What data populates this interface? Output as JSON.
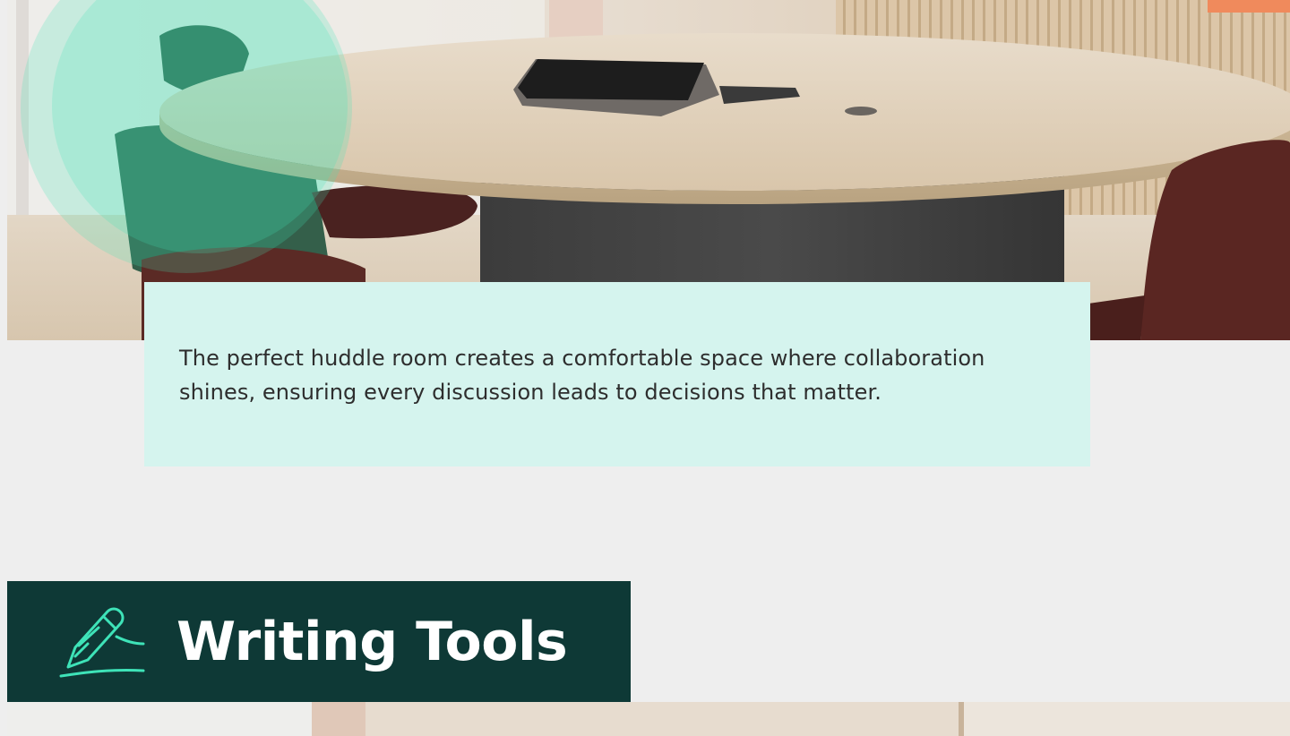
{
  "hero": {
    "accent_color": "#3ee3b8"
  },
  "caption": {
    "text": "The perfect huddle room creates a comfortable space where collaboration shines, ensuring every discussion leads to decisions that matter.",
    "background": "#d5f4ee"
  },
  "section": {
    "title": "Writing Tools",
    "icon": "pen-writing-icon",
    "background": "#0e3936",
    "icon_color": "#3ee3b8"
  }
}
